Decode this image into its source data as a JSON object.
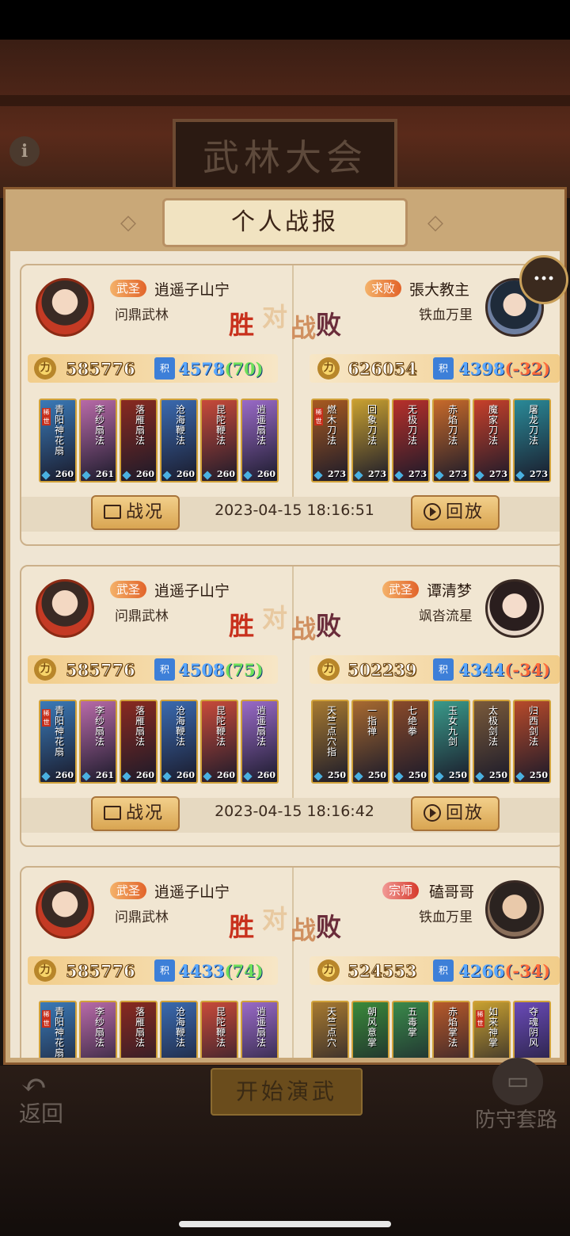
{
  "hall": {
    "sign": "武林大会",
    "info": "i"
  },
  "panel": {
    "title": "个人战报"
  },
  "vs": {
    "win": "胜",
    "dui": "对",
    "zhan": "战",
    "lose": "败"
  },
  "footer": {
    "details_label": "战况",
    "replay_label": "回放"
  },
  "bottom": {
    "back_label": "返回",
    "start_label": "开始演武",
    "defense_label": "防守套路"
  },
  "battles": [
    {
      "left": {
        "rank": "武圣",
        "name": "逍遥子山宁",
        "guild": "问鼎武林",
        "power": "585776",
        "score": "4578",
        "delta": "(70)",
        "heroes": [
          {
            "name": "青阳神花扇",
            "badge": "稀世",
            "level": "260",
            "color": "#3a7ab8"
          },
          {
            "name": "李纱扇法",
            "badge": "",
            "level": "261",
            "color": "#b86aa8"
          },
          {
            "name": "落雁扇法",
            "badge": "",
            "level": "260",
            "color": "#8a2a20"
          },
          {
            "name": "沧海鞭法",
            "badge": "",
            "level": "260",
            "color": "#3a6ab0"
          },
          {
            "name": "昆陀鞭法",
            "badge": "",
            "level": "260",
            "color": "#c84a3a"
          },
          {
            "name": "逍遥扇法",
            "badge": "",
            "level": "260",
            "color": "#9a6ac8"
          }
        ]
      },
      "right": {
        "rank": "求败",
        "name": "張大教主",
        "guild": "铁血万里",
        "power": "626054",
        "score": "4398",
        "delta": "(-32)",
        "heroes": [
          {
            "name": "燃木刀法",
            "badge": "稀世",
            "level": "273",
            "color": "#a85a20"
          },
          {
            "name": "回象刀法",
            "badge": "",
            "level": "273",
            "color": "#c8a030"
          },
          {
            "name": "无极刀法",
            "badge": "",
            "level": "273",
            "color": "#b8302a"
          },
          {
            "name": "赤焰刀法",
            "badge": "",
            "level": "273",
            "color": "#c86a2a"
          },
          {
            "name": "魔家刀法",
            "badge": "",
            "level": "273",
            "color": "#c8402a"
          },
          {
            "name": "屠龙刀法",
            "badge": "",
            "level": "273",
            "color": "#2a8a98"
          }
        ]
      },
      "time": "2023-04-15 18:16:51"
    },
    {
      "left": {
        "rank": "武圣",
        "name": "逍遥子山宁",
        "guild": "问鼎武林",
        "power": "585776",
        "score": "4508",
        "delta": "(75)",
        "heroes": [
          {
            "name": "青阳神花扇",
            "badge": "稀世",
            "level": "260",
            "color": "#3a7ab8"
          },
          {
            "name": "李纱扇法",
            "badge": "",
            "level": "261",
            "color": "#b86aa8"
          },
          {
            "name": "落雁扇法",
            "badge": "",
            "level": "260",
            "color": "#8a2a20"
          },
          {
            "name": "沧海鞭法",
            "badge": "",
            "level": "260",
            "color": "#3a6ab0"
          },
          {
            "name": "昆陀鞭法",
            "badge": "",
            "level": "260",
            "color": "#c84a3a"
          },
          {
            "name": "逍遥扇法",
            "badge": "",
            "level": "260",
            "color": "#9a6ac8"
          }
        ]
      },
      "right": {
        "rank": "武圣",
        "name": "谭清梦",
        "guild": "飒沓流星",
        "power": "502239",
        "score": "4344",
        "delta": "(-34)",
        "heroes": [
          {
            "name": "天竺点穴指",
            "badge": "",
            "level": "250",
            "color": "#a87a30"
          },
          {
            "name": "一指禅",
            "badge": "",
            "level": "250",
            "color": "#a86a30"
          },
          {
            "name": "七绝拳",
            "badge": "",
            "level": "250",
            "color": "#8a4a2a"
          },
          {
            "name": "玉女九剑",
            "badge": "",
            "level": "250",
            "color": "#3a9a8a"
          },
          {
            "name": "太极剑法",
            "badge": "",
            "level": "250",
            "color": "#7a5a3a"
          },
          {
            "name": "归西剑法",
            "badge": "",
            "level": "250",
            "color": "#b84a2a"
          }
        ]
      },
      "time": "2023-04-15 18:16:42"
    },
    {
      "left": {
        "rank": "武圣",
        "name": "逍遥子山宁",
        "guild": "问鼎武林",
        "power": "585776",
        "score": "4433",
        "delta": "(74)",
        "heroes": [
          {
            "name": "青阳神花扇",
            "badge": "稀世",
            "level": "",
            "color": "#3a7ab8"
          },
          {
            "name": "李纱扇法",
            "badge": "",
            "level": "",
            "color": "#b86aa8"
          },
          {
            "name": "落雁扇法",
            "badge": "",
            "level": "",
            "color": "#8a2a20"
          },
          {
            "name": "沧海鞭法",
            "badge": "",
            "level": "",
            "color": "#3a6ab0"
          },
          {
            "name": "昆陀鞭法",
            "badge": "",
            "level": "",
            "color": "#c84a3a"
          },
          {
            "name": "逍遥扇法",
            "badge": "",
            "level": "",
            "color": "#9a6ac8"
          }
        ]
      },
      "right": {
        "rank": "宗师",
        "name": "磕哥哥",
        "guild": "铁血万里",
        "power": "524553",
        "score": "4266",
        "delta": "(-34)",
        "heroes": [
          {
            "name": "天竺点穴",
            "badge": "",
            "level": "",
            "color": "#a87a30"
          },
          {
            "name": "朝风意掌",
            "badge": "",
            "level": "",
            "color": "#3a8a3a"
          },
          {
            "name": "五毒掌",
            "badge": "",
            "level": "",
            "color": "#3a8a4a"
          },
          {
            "name": "赤焰掌法",
            "badge": "",
            "level": "",
            "color": "#b85a2a"
          },
          {
            "name": "如来神掌",
            "badge": "稀世",
            "level": "",
            "color": "#c8a030"
          },
          {
            "name": "夺魂阴风",
            "badge": "",
            "level": "",
            "color": "#6a4ab8"
          }
        ]
      },
      "time": ""
    }
  ]
}
